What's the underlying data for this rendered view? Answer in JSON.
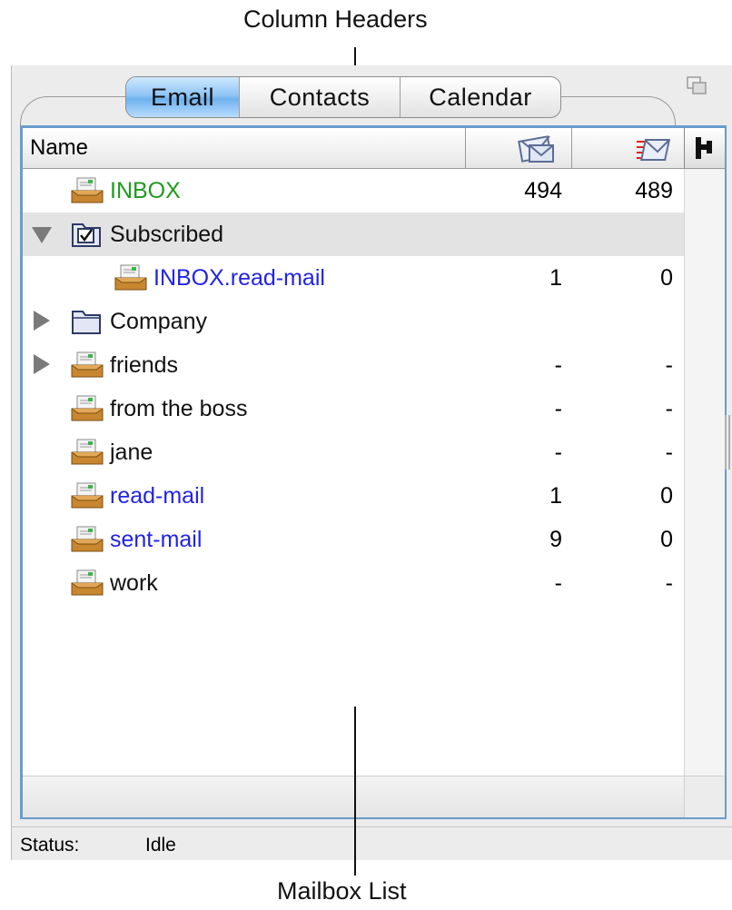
{
  "annotations": {
    "top": "Column Headers",
    "bottom": "Mailbox List"
  },
  "tabs": [
    {
      "label": "Email",
      "active": true
    },
    {
      "label": "Contacts",
      "active": false
    },
    {
      "label": "Calendar",
      "active": false
    }
  ],
  "columns": {
    "name": "Name",
    "unread_icon": "envelope-icon",
    "new_icon": "new-mail-icon",
    "toggle_icon": "hierarchy-icon"
  },
  "mailboxes": [
    {
      "label": "INBOX",
      "color": "green",
      "icon": "mailbox-tray-icon",
      "disclosure": "none",
      "count1": "494",
      "count2": "489"
    },
    {
      "label": "Subscribed",
      "color": "plain",
      "icon": "checked-folder-icon",
      "disclosure": "expanded",
      "count1": "",
      "count2": "",
      "selected": true
    },
    {
      "label": "INBOX.read-mail",
      "color": "blue",
      "icon": "mailbox-tray-icon",
      "disclosure": "none",
      "indent": 1,
      "count1": "1",
      "count2": "0"
    },
    {
      "label": "Company",
      "color": "plain",
      "icon": "folder-icon",
      "disclosure": "collapsed",
      "count1": "",
      "count2": ""
    },
    {
      "label": "friends",
      "color": "plain",
      "icon": "mailbox-tray-icon",
      "disclosure": "collapsed",
      "count1": "-",
      "count2": "-"
    },
    {
      "label": "from the boss",
      "color": "plain",
      "icon": "mailbox-tray-icon",
      "disclosure": "none",
      "count1": "-",
      "count2": "-"
    },
    {
      "label": "jane",
      "color": "plain",
      "icon": "mailbox-tray-icon",
      "disclosure": "none",
      "count1": "-",
      "count2": "-"
    },
    {
      "label": "read-mail",
      "color": "blue",
      "icon": "mailbox-tray-icon",
      "disclosure": "none",
      "count1": "1",
      "count2": "0"
    },
    {
      "label": "sent-mail",
      "color": "blue",
      "icon": "mailbox-tray-icon",
      "disclosure": "none",
      "count1": "9",
      "count2": "0"
    },
    {
      "label": "work",
      "color": "plain",
      "icon": "mailbox-tray-icon",
      "disclosure": "none",
      "count1": "-",
      "count2": "-"
    }
  ],
  "status": {
    "label": "Status:",
    "value": "Idle"
  },
  "colors": {
    "green": "#1f9a1f",
    "blue": "#2222e6",
    "accent": "#6a9ccc",
    "selected_row": "#e3e3e3"
  }
}
